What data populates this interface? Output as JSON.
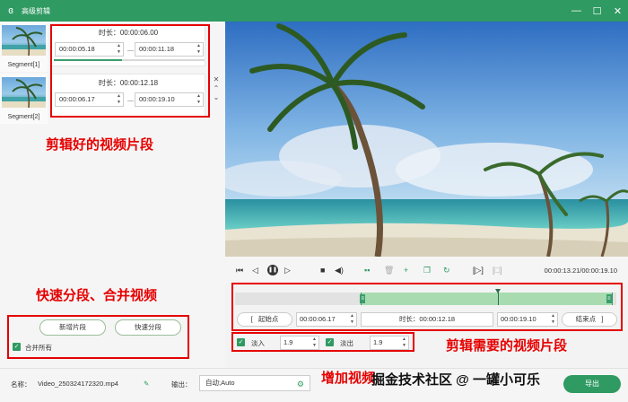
{
  "window": {
    "title": "高级剪辑",
    "controls": [
      "—",
      "☐",
      "✕"
    ]
  },
  "segments_panel": {
    "thumbnails": [
      {
        "label": "Segment[1]"
      },
      {
        "label": "Segment[2]"
      }
    ],
    "cards": [
      {
        "duration": "时长：00:00:06.00",
        "start": "00:00:05.18",
        "end": "00:00:11.18",
        "progress": 0.45
      },
      {
        "duration": "时长：00:00:12.18",
        "start": "00:00:06.17",
        "end": "00:00:19.10"
      }
    ],
    "card_controls": [
      "✕",
      "⌃",
      "⌄"
    ],
    "add_segment_label": "新增片段",
    "quick_split_label": "快速分段",
    "merge_all_label": "合并所有",
    "merge_all_checked": true
  },
  "player": {
    "controls": [
      "to-start",
      "step-back",
      "pause",
      "step-forward",
      "stop",
      "volume",
      "split",
      "delete",
      "add",
      "copy",
      "rotate",
      "crop-mark",
      "crop-mark-2"
    ],
    "time_readout": "00:00:13.21/00:00:19.10"
  },
  "timeline": {
    "selection_start": 0.33,
    "selection_end": 0.99,
    "playhead": 0.69,
    "start_point_label": "起始点",
    "start_time": "00:00:06.17",
    "duration": "时长：00:00:12.18",
    "end_time": "00:00:19.10",
    "end_point_label": "结束点",
    "fade_in_label": "淡入",
    "fade_in_value": "1.9",
    "fade_out_label": "淡出",
    "fade_out_value": "1.9"
  },
  "bottom_bar": {
    "name_label": "名称：",
    "file_name": "Video_250324172320.mp4",
    "output_label": "输出：",
    "output_value": "自动;Auto",
    "export_label": "导出"
  },
  "annotations": {
    "cut_segments": "剪辑好的视频片段",
    "quick_split_merge": "快速分段、合并视频",
    "cut_needed": "剪辑需要的视频片段",
    "add_fade": "增加视频"
  },
  "watermark": "掘金技术社区 @ 一罐小可乐",
  "colors": {
    "accent": "#2f9a62",
    "annotation": "#e60000"
  }
}
